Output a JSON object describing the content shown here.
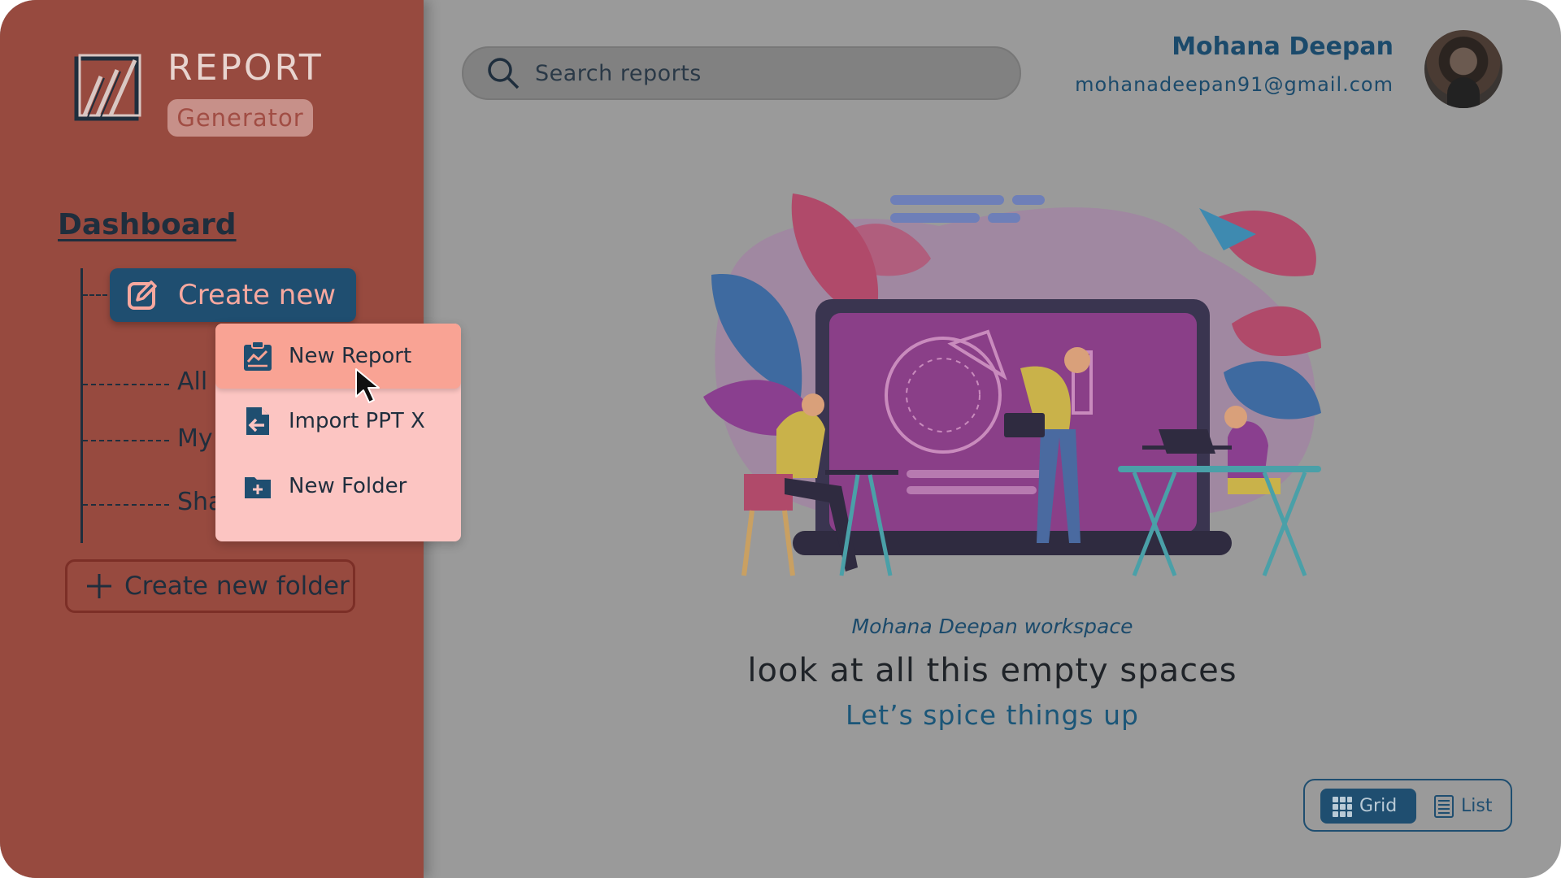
{
  "brand": {
    "title": "REPORT",
    "subtitle": "Generator",
    "logo_icon": "slashed-square-logo"
  },
  "sidebar": {
    "heading": "Dashboard",
    "create_button": {
      "label": "Create new",
      "icon": "edit-icon"
    },
    "items": [
      {
        "label": "All"
      },
      {
        "label": "My"
      },
      {
        "label": "Sha"
      }
    ],
    "new_folder_button": {
      "label": "Create new folder",
      "icon": "plus-icon"
    }
  },
  "dropdown": {
    "items": [
      {
        "label": "New Report",
        "icon": "chart-clipboard-icon",
        "active": true
      },
      {
        "label": "Import PPT X",
        "icon": "import-file-icon",
        "active": false
      },
      {
        "label": "New Folder",
        "icon": "folder-plus-icon",
        "active": false
      }
    ]
  },
  "search": {
    "placeholder": "Search reports",
    "icon": "search-icon"
  },
  "user": {
    "name": "Mohana Deepan",
    "email": "mohanadeepan91@gmail.com"
  },
  "workspace": {
    "owner": "Mohana Deepan",
    "suffix": "workspace",
    "headline": "look at all this empty spaces",
    "subline": "Let’s spice things up"
  },
  "view_toggle": {
    "grid": "Grid",
    "list": "List",
    "selected": "Grid"
  },
  "colors": {
    "sidebar_bg": "#974a3f",
    "main_bg": "#9a9a9a",
    "accent_navy": "#1f4e70",
    "dropdown_bg": "#fcc5c2",
    "dropdown_active": "#f9a394"
  }
}
